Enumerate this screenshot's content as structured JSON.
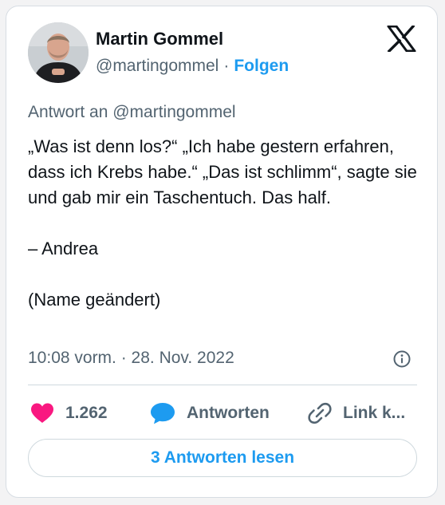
{
  "author": {
    "name": "Martin Gommel",
    "handle": "@martingommel",
    "separator": "·",
    "follow_label": "Folgen"
  },
  "tweet": {
    "reply_to": "Antwort an @martingommel",
    "paragraphs": [
      "„Was ist denn los?“ „Ich habe gestern erfahren, dass ich Krebs habe.“ „Das ist schlimm“, sagte sie und gab mir ein Taschentuch. Das half.",
      "– Andrea",
      "(Name geändert)"
    ],
    "timestamp": "10:08 vorm. · 28. Nov. 2022"
  },
  "actions": {
    "like_count": "1.262",
    "reply_label": "Antworten",
    "link_label": "Link k..."
  },
  "footer": {
    "read_replies_label": "3 Antworten lesen"
  },
  "icons": {
    "brand": "x-logo-icon",
    "info": "info-icon",
    "like": "heart-icon",
    "reply": "speech-bubble-icon",
    "link": "link-icon"
  },
  "colors": {
    "accent": "#1d9bf0",
    "like": "#f91880",
    "text": "#0f1419",
    "secondary": "#536471",
    "border": "#cfd9de"
  }
}
